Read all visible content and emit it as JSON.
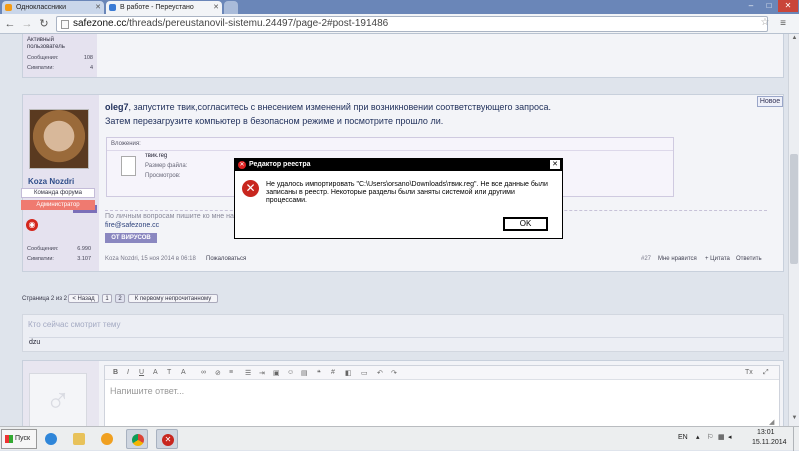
{
  "browser": {
    "tabs": [
      {
        "label": "Одноклассники",
        "active": false
      },
      {
        "label": "В работе - Переустано",
        "active": true
      }
    ],
    "url_domain": "safezone.cc",
    "url_path": "/threads/pereustanovil-sistemu.24497/page-2#post-191486"
  },
  "prev_post": {
    "user_title": "Активный пользователь",
    "stats": [
      {
        "label": "Сообщения:",
        "value": "108"
      },
      {
        "label": "Симпатии:",
        "value": "4"
      }
    ]
  },
  "post": {
    "new_badge": "Новое",
    "author": "Koza Nozdri",
    "online_badge": "Онлайн",
    "team_badge": "Команда форума",
    "role_badge": "Администратор",
    "stats": [
      {
        "label": "Сообщения:",
        "value": "6.990"
      },
      {
        "label": "Симпатии:",
        "value": "3.107"
      }
    ],
    "mention": "oleg7",
    "line1_rest": ", запустите твик,согласитесь с внесением изменений при возникновении соответствующего запроса.",
    "line2": "Затем перезагрузите компьютер в безопасном режиме и посмотрите прошло ли.",
    "attachments_label": "Вложения:",
    "file_name": "твик.reg",
    "file_size_label": "Размер файла:",
    "file_views_label": "Просмотров:",
    "signature_line": "По личным вопросам пишите ко мне на",
    "signature_email": "fire@safezone.cc",
    "signature_banner": "ОТ ВИРУСОВ",
    "meta": "Koza Nozdri, 15 ноя 2014 в 06:18",
    "report": "Пожаловаться",
    "post_number": "#27",
    "like": "Мне нравится",
    "quote": "+ Цитата",
    "reply": "Ответить"
  },
  "pagination": {
    "label": "Страница 2 из 2",
    "back": "< Назад",
    "pages": [
      "1",
      "2"
    ],
    "first_unread": "К первому непрочитанному"
  },
  "viewers": {
    "title": "Кто сейчас смотрит тему",
    "names": "dzu"
  },
  "editor": {
    "placeholder": "Напишите ответ...",
    "toolbar_icons": [
      "bold-icon",
      "italic-icon",
      "underline-icon",
      "text-color-icon",
      "text-size-icon",
      "font-icon",
      "link-icon",
      "unlink-icon",
      "image-icon",
      "smiley-icon",
      "media-icon",
      "quote-icon",
      "code-icon",
      "spoiler-icon",
      "save-icon",
      "undo-icon",
      "redo-icon"
    ]
  },
  "dialog": {
    "title": "Редактор реестра",
    "message": "Не удалось импортировать \"C:\\Users\\orsano\\Downloads\\твик.reg\". Не все данные были записаны в реестр. Некоторые разделы были заняты системой или другими процессами.",
    "ok": "OK"
  },
  "taskbar": {
    "start": "Пуск",
    "lang": "EN",
    "time": "13:01",
    "date": "15.11.2014"
  }
}
